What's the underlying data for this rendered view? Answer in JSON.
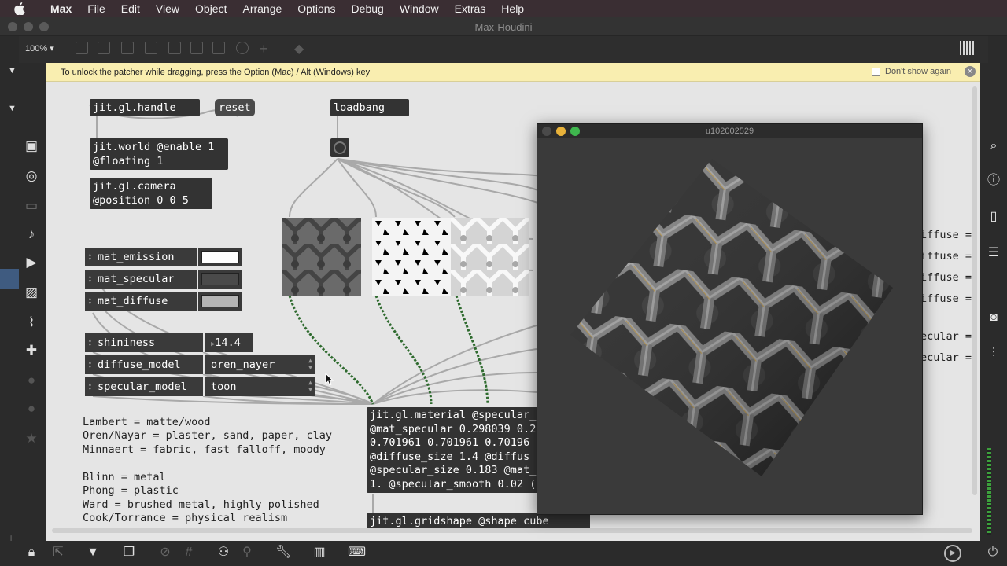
{
  "menubar": {
    "items": [
      "Max",
      "File",
      "Edit",
      "View",
      "Object",
      "Arrange",
      "Options",
      "Debug",
      "Window",
      "Extras",
      "Help"
    ]
  },
  "window": {
    "title": "Max-Houdini"
  },
  "toolbar": {
    "zoom": "100%"
  },
  "notice": {
    "text": "To unlock the patcher while dragging, press the Option (Mac) / Alt (Windows) key",
    "dont_show": "Don't show again"
  },
  "objects": {
    "handle": "jit.gl.handle",
    "reset": "reset",
    "loadbang": "loadbang",
    "world": "jit.world @enable 1\n@floating 1",
    "camera": "jit.gl.camera\n@position 0 0 5",
    "material": "jit.gl.material @specular_\n@mat_specular 0.298039 0.2\n0.701961 0.701961 0.70196\n@diffuse_size 1.4 @diffus\n@specular_size 0.183 @mat_\n1. @specular_smooth 0.02 (",
    "gridshape": "jit.gl.gridshape @shape cube"
  },
  "attrui": [
    {
      "name": "mat_emission",
      "swatch": "#ffffff"
    },
    {
      "name": "mat_specular",
      "swatch": "#4a4a4a"
    },
    {
      "name": "mat_diffuse",
      "swatch": "#b4b4b4"
    }
  ],
  "params": [
    {
      "name": "shininess",
      "value": "14.4"
    },
    {
      "name": "diffuse_model",
      "value": "oren_nayer"
    },
    {
      "name": "specular_model",
      "value": "toon"
    }
  ],
  "comments": {
    "diffuse": "Lambert = matte/wood\nOren/Nayar = plaster, sand, paper, clay\nMinnaert = fabric, fast falloff, moody",
    "specular": "Blinn = metal\nPhong = plastic\nWard = brushed metal, highly polished\nCook/Torrance = physical realism"
  },
  "hidden_labels": [
    "iffuse =",
    "iffuse =",
    "iffuse =",
    "iffuse =",
    "ecular =",
    "ecular ="
  ],
  "jit_window": {
    "title": "u102002529"
  },
  "colors": {
    "canvas": "#e5e5e5",
    "object": "#333333",
    "notice": "#f9eeb0",
    "patchcord_green": "#3d7a3d"
  }
}
